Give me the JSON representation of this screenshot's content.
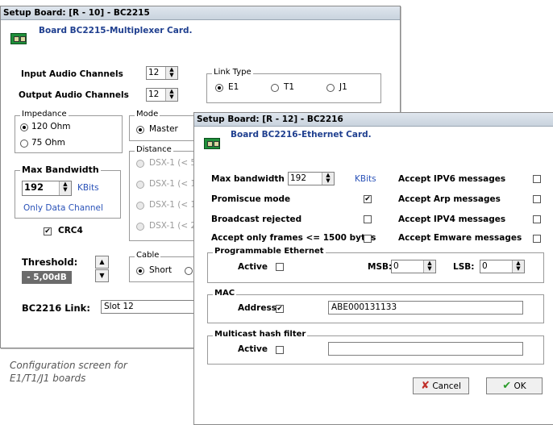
{
  "win1": {
    "title": "Setup Board: [R - 10] - BC2215",
    "board_title": "Board BC2215-Multiplexer Card.",
    "input_audio_label": "Input Audio Channels",
    "input_audio_value": "12",
    "output_audio_label": "Output Audio Channels",
    "output_audio_value": "12",
    "link_type": {
      "legend": "Link Type",
      "options": [
        "E1",
        "T1",
        "J1"
      ],
      "selected": "E1"
    },
    "impedance": {
      "legend": "Impedance",
      "options": [
        "120 Ohm",
        "75 Ohm"
      ],
      "selected": "120 Ohm"
    },
    "mode": {
      "legend": "Mode",
      "options": [
        "Master"
      ],
      "selected": "Master"
    },
    "distance": {
      "legend": "Distance",
      "options": [
        "DSX-1 (< 5(",
        "DSX-1 (< 10",
        "DSX-1 (< 15",
        "DSX-1 (< 20"
      ]
    },
    "max_bandwidth": {
      "legend": "Max Bandwidth",
      "value": "192",
      "unit": "KBits",
      "note": "Only Data Channel"
    },
    "crc4_label": "CRC4",
    "crc4_checked": "✔",
    "threshold_label": "Threshold:",
    "threshold_value": "- 5,00dB",
    "cable": {
      "legend": "Cable",
      "options": [
        "Short"
      ],
      "selected": "Short"
    },
    "bc2216_link_label": "BC2216 Link:",
    "bc2216_link_value": "Slot 12"
  },
  "caption": {
    "line1": "Configuration screen for",
    "line2": "E1/T1/J1 boards"
  },
  "win2": {
    "title": "Setup Board: [R - 12] - BC2216",
    "board_title": "Board BC2216-Ethernet Card.",
    "max_bw_label": "Max bandwidth",
    "max_bw_value": "192",
    "max_bw_unit": "KBits",
    "promiscue_label": "Promiscue mode",
    "promiscue_checked": "✔",
    "broadcast_label": "Broadcast rejected",
    "accept_frames_label": "Accept only frames <= 1500 bytes",
    "ipv6_label": "Accept IPV6 messages",
    "arp_label": "Accept Arp messages",
    "ipv4_label": "Accept IPV4 messages",
    "emware_label": "Accept Emware messages",
    "prog_eth": {
      "legend": "Programmable Ethernet",
      "active_label": "Active",
      "msb_label": "MSB:",
      "msb_value": "0",
      "lsb_label": "LSB:",
      "lsb_value": "0"
    },
    "mac": {
      "legend": "MAC",
      "address_label": "Address",
      "address_checked": "✔",
      "address_value": "ABE000131133"
    },
    "multicast": {
      "legend": "Multicast hash filter",
      "active_label": "Active",
      "value": ""
    },
    "cancel_label": "Cancel",
    "ok_label": "OK"
  }
}
